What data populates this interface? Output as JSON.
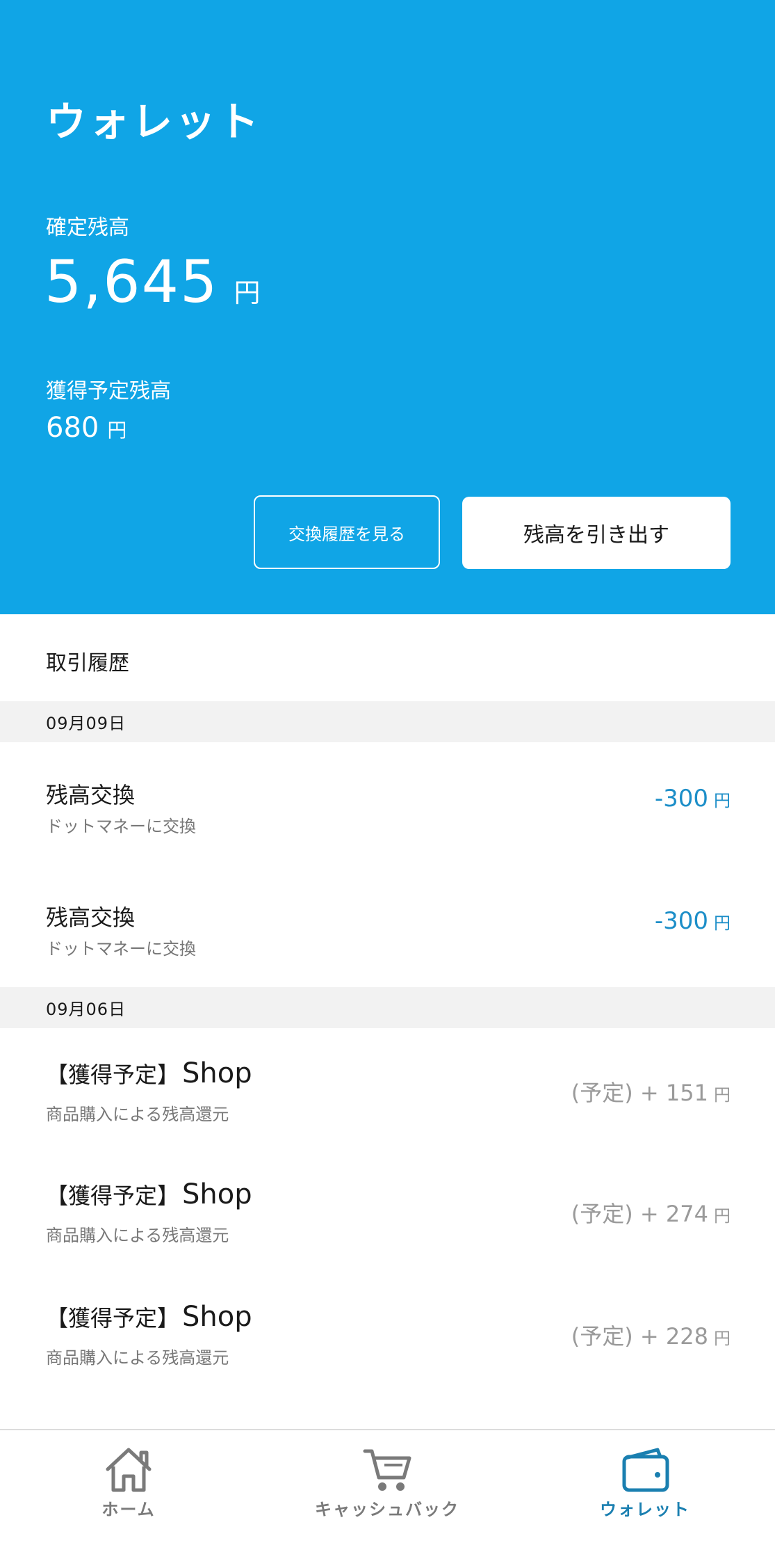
{
  "header": {
    "title": "ウォレット",
    "confirmed_label": "確定残高",
    "confirmed_amount": "5,645",
    "currency": "円",
    "pending_label": "獲得予定残高",
    "pending_amount": "680",
    "history_button": "交換履歴を見る",
    "withdraw_button": "残高を引き出す"
  },
  "transactions": {
    "section_title": "取引履歴",
    "groups": [
      {
        "date": "09月09日",
        "items": [
          {
            "title": "残高交換",
            "subtitle": "ドットマネーに交換",
            "amount": "-300"
          },
          {
            "title": "残高交換",
            "subtitle": "ドットマネーに交換",
            "amount": "-300"
          }
        ]
      },
      {
        "date": "09月06日",
        "items": [
          {
            "title_prefix": "【獲得予定】",
            "title_suffix": "Shop",
            "subtitle": "商品購入による残高還元",
            "amount": "(予定) + 151"
          },
          {
            "title_prefix": "【獲得予定】",
            "title_suffix": "Shop",
            "subtitle": "商品購入による残高還元",
            "amount": "(予定) + 274"
          },
          {
            "title_prefix": "【獲得予定】",
            "title_suffix": "Shop",
            "subtitle": "商品購入による残高還元",
            "amount": "(予定) + 228"
          }
        ]
      }
    ]
  },
  "tabbar": {
    "tabs": [
      {
        "label": "ホーム",
        "icon": "home-icon"
      },
      {
        "label": "キャッシュバック",
        "icon": "cart-icon"
      },
      {
        "label": "ウォレット",
        "icon": "wallet-icon",
        "active": true
      }
    ]
  },
  "colors": {
    "header_bg": "#10a5e6",
    "negative_amount": "#1c8ec8",
    "pending_amount": "#9a9a9a",
    "active_tab": "#1a7fb0",
    "inactive_tab": "#7a7a7a"
  }
}
